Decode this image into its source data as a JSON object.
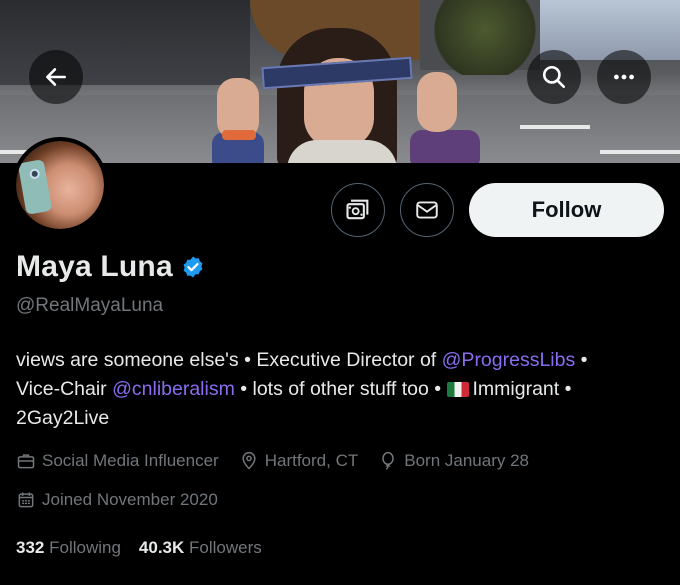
{
  "profile": {
    "name": "Maya Luna",
    "handle": "@RealMayaLuna",
    "verified": true,
    "verified_color": "#1d9bf0"
  },
  "actions": {
    "follow_label": "Follow",
    "subscribe_icon": "subscribe-icon",
    "message_icon": "mail-icon"
  },
  "nav": {
    "back_icon": "arrow-left-icon",
    "search_icon": "search-icon",
    "more_icon": "more-dots-icon"
  },
  "bio": {
    "t1": "views are someone else's • Executive Director of ",
    "link1": "@ProgressLibs",
    "t2": " •",
    "t3": "Vice-Chair ",
    "link2": "@cnliberalism",
    "t4": " • lots of other stuff too • ",
    "t5": "Immigrant •",
    "t6": "2Gay2Live"
  },
  "meta": {
    "category": "Social Media Influencer",
    "location": "Hartford, CT",
    "birthday": "Born January 28",
    "joined": "Joined November 2020"
  },
  "stats": {
    "following_count": "332",
    "following_label": "Following",
    "followers_count": "40.3K",
    "followers_label": "Followers"
  },
  "colors": {
    "background": "#000000",
    "text": "#e7e9ea",
    "secondary": "#71767b",
    "link": "#8a6cf0",
    "follow_bg": "#eff3f4"
  }
}
